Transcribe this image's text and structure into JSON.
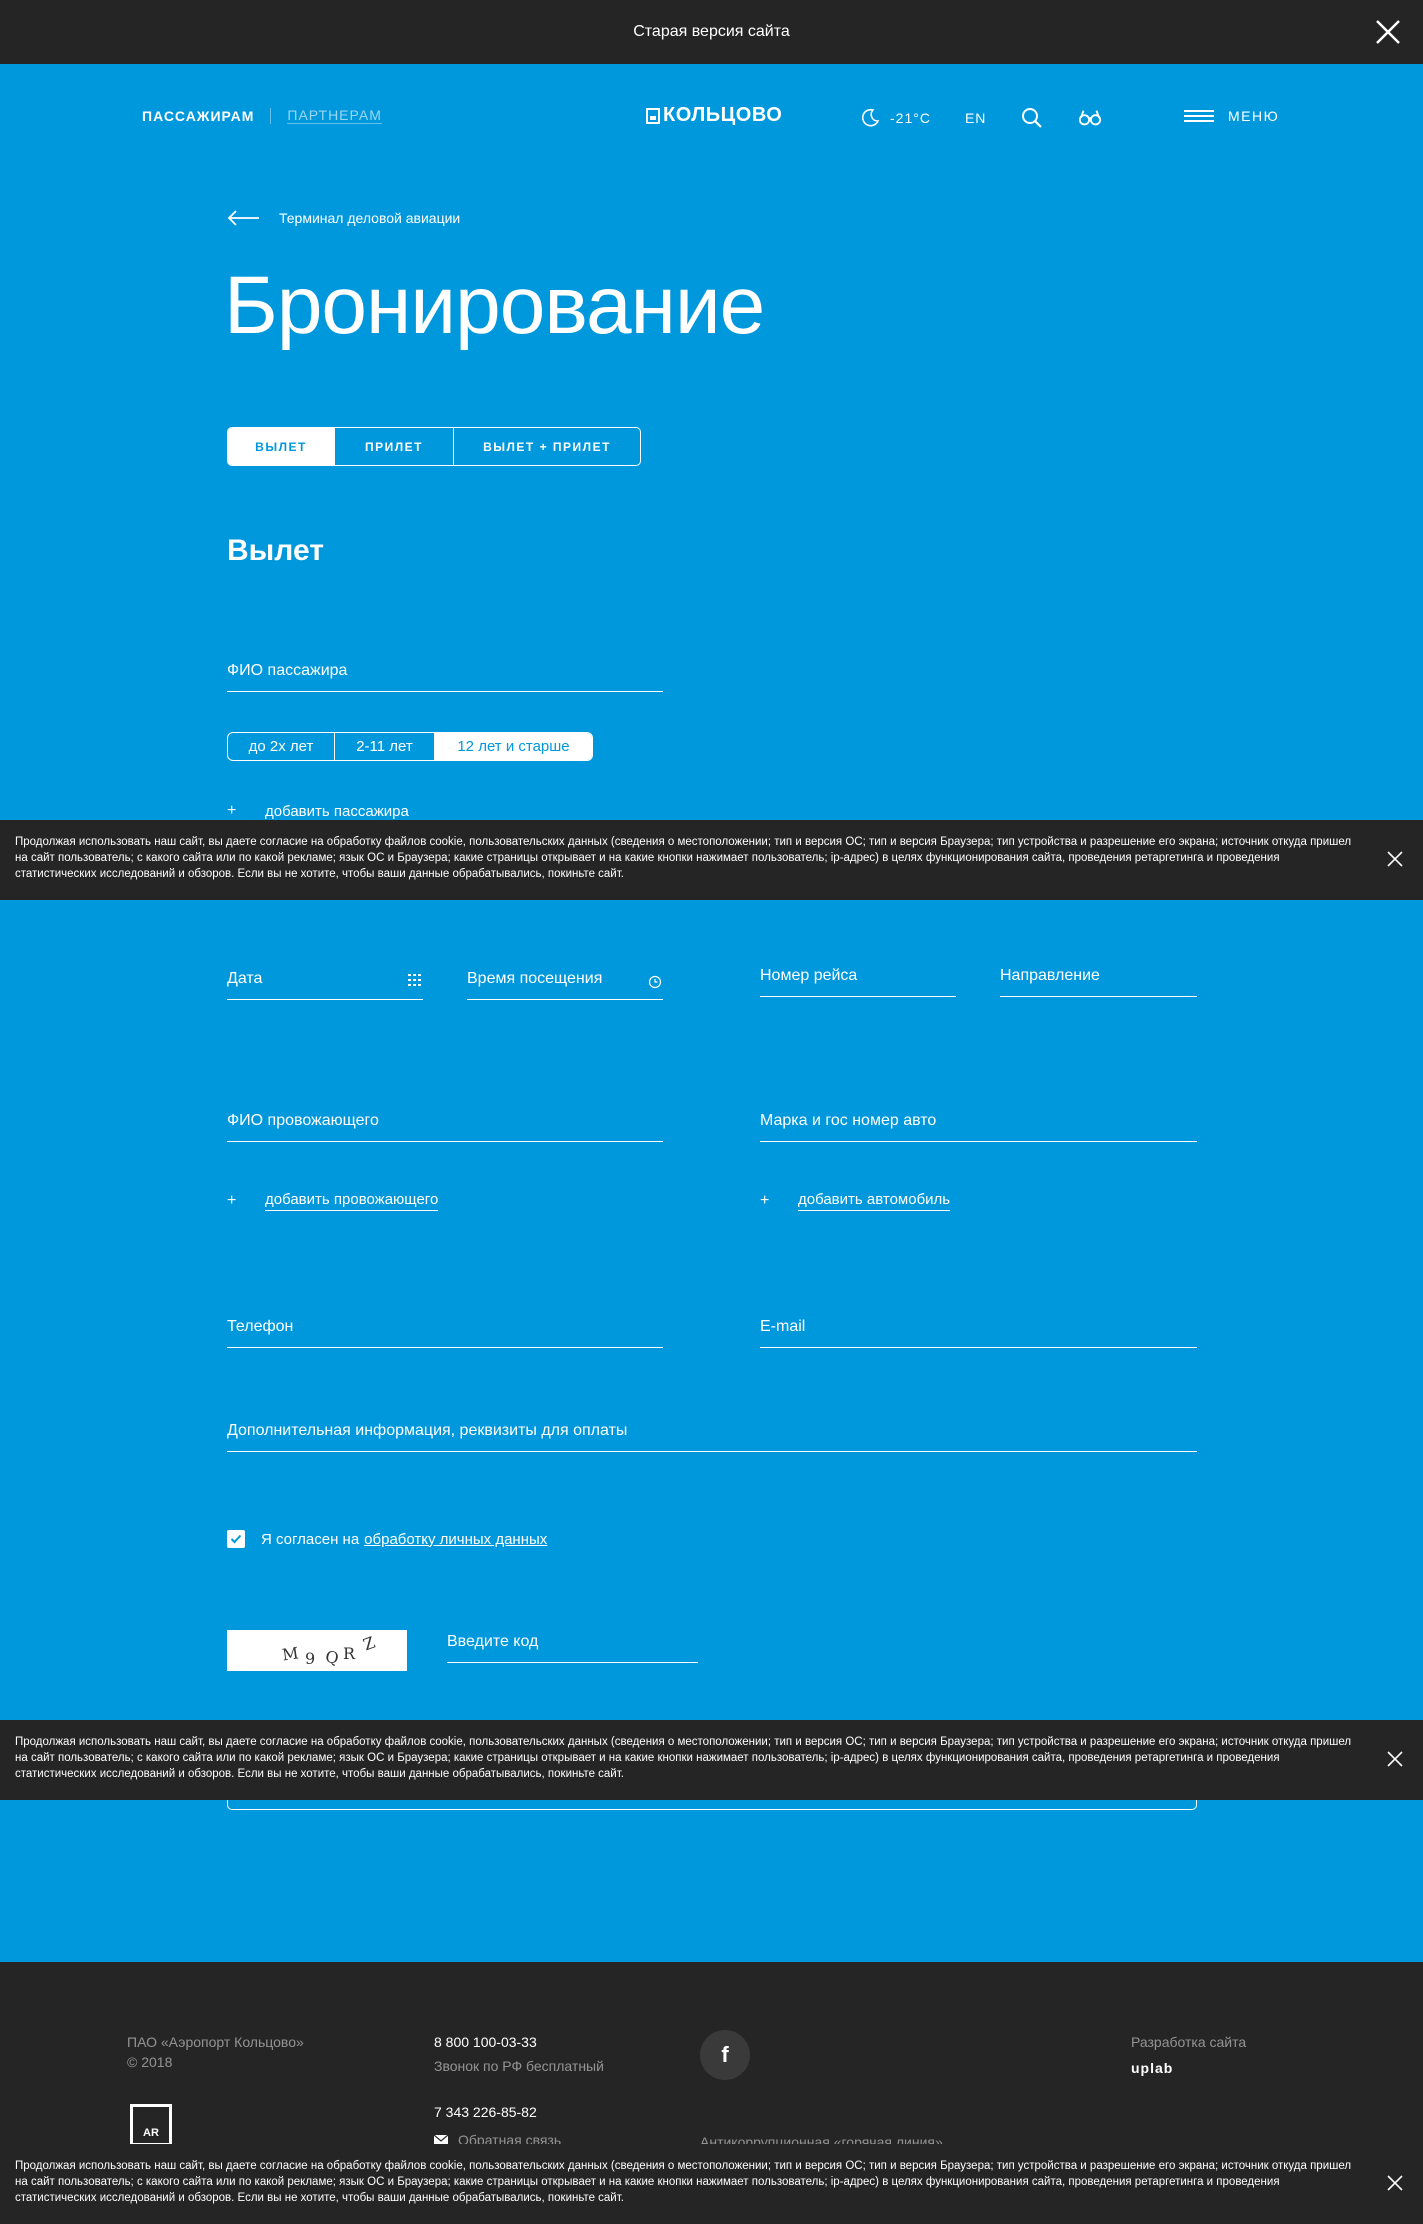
{
  "topbar": {
    "label": "Старая версия сайта"
  },
  "header": {
    "nav": {
      "passengers": "ПАССАЖИРАМ",
      "partners": "ПАРТНЕРАМ"
    },
    "logo": "КОЛЬЦОВО",
    "weather": "-21°C",
    "lang": "EN",
    "menu": "МЕНЮ",
    "icons": [
      "moon-icon",
      "search-icon",
      "glasses-icon",
      "burger-icon"
    ]
  },
  "breadcrumb": {
    "back": "Терминал деловой авиации"
  },
  "page_title": "Бронирование",
  "tabs": [
    {
      "label": "ВЫЛЕТ",
      "active": true
    },
    {
      "label": "ПРИЛЕТ",
      "active": false
    },
    {
      "label": "ВЫЛЕТ + ПРИЛЕТ",
      "active": false
    }
  ],
  "section_title": "Вылет",
  "form": {
    "passenger_name": "ФИО пассажира",
    "age_options": [
      "до 2х лет",
      "2-11 лет",
      "12 лет и старше"
    ],
    "age_selected": "12 лет и старше",
    "add_passenger": "добавить пассажира",
    "date": "Дата",
    "visit_time": "Время посещения",
    "flight_number": "Номер рейса",
    "direction": "Направление",
    "escort_name": "ФИО провожающего",
    "car": "Марка и гос номер авто",
    "add_escort": "добавить провожающего",
    "add_car": "добавить автомобиль",
    "phone": "Телефон",
    "email": "E-mail",
    "extra_info": "Дополнительная информация, реквизиты для оплаты",
    "consent_text": "Я согласен на",
    "consent_link": "обработку личных данных",
    "consent_checked": true,
    "captcha_text": "M9QRZ",
    "captcha_input": "Введите код",
    "plus": "+"
  },
  "cookie": {
    "text": "Продолжая использовать наш сайт, вы даете согласие на обработку файлов cookie, пользовательских данных (сведения о местоположении; тип и версия ОС; тип и версия Браузера; тип устройства и разрешение его экрана; источник откуда пришел на сайт пользователь; с какого сайта или по какой рекламе; язык ОС и Браузера; какие страницы открывает и на какие кнопки нажимает пользователь; ip-адрес) в целях функционирования сайта, проведения ретаргетинга и проведения статистических исследований и обзоров. Если вы не хотите, чтобы ваши данные обрабатывались, покиньте сайт."
  },
  "footer": {
    "company": "ПАО «Аэропорт Кольцово»",
    "year": "© 2018",
    "phone1": "8 800 100-03-33",
    "phone1_note": "Звонок по РФ бесплатный",
    "phone2": "7 343 226-85-82",
    "feedback": "Обратная связь",
    "facebook": "f",
    "anticorruption": "Антикоррупционная «горячая линия»",
    "dev_label": "Разработка сайта",
    "dev_name": "uplab",
    "ar_logo": "AR"
  },
  "colors": {
    "brand_blue": "#0098dc",
    "dark": "#252525"
  }
}
